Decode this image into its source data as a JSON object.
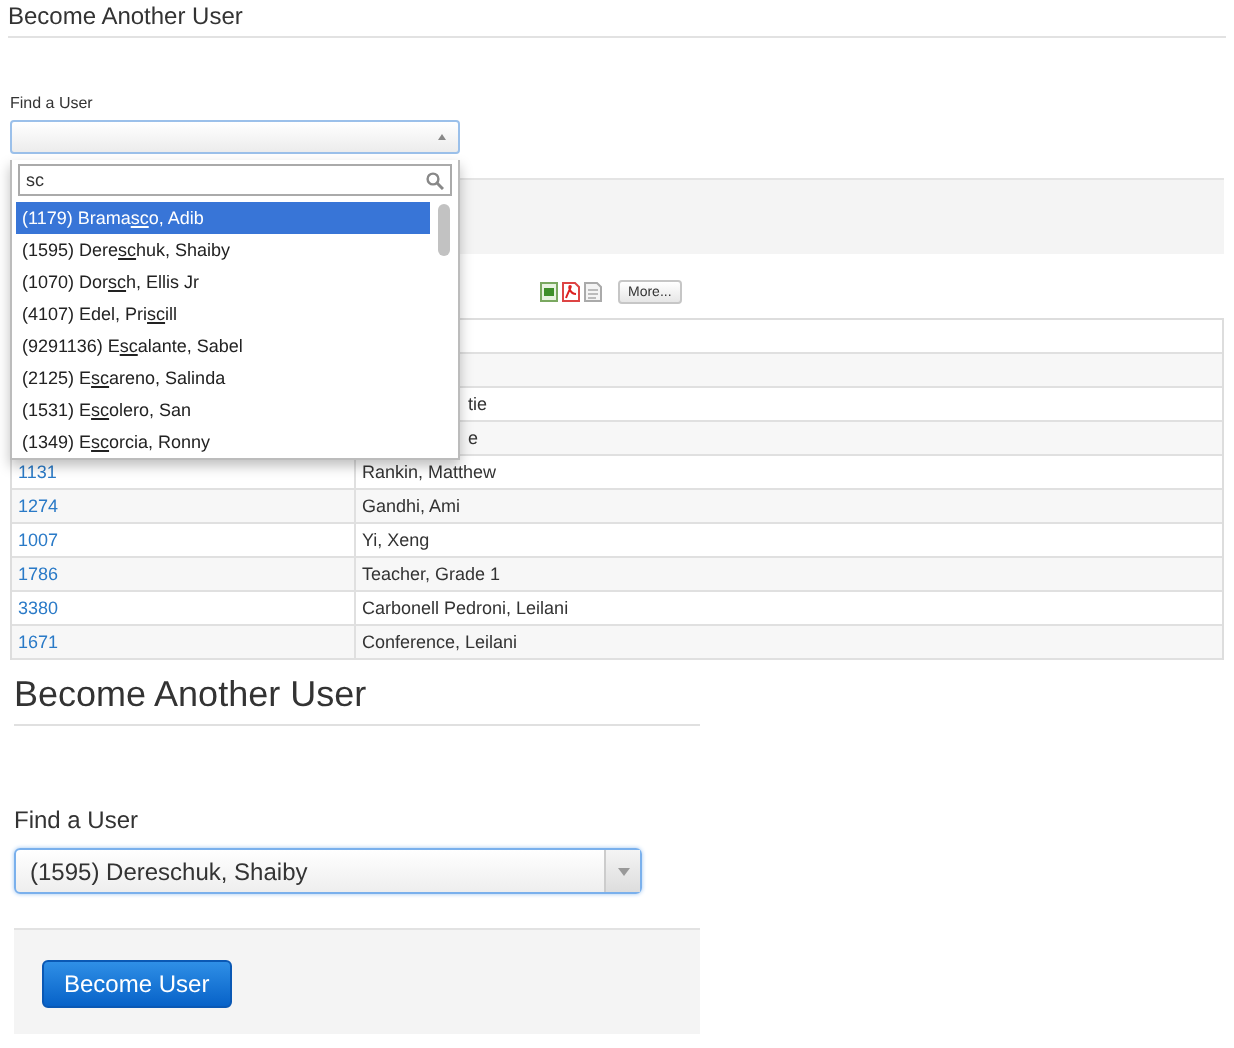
{
  "top_view": {
    "title": "Become Another User",
    "field_label": "Find a User",
    "select": {
      "expanded": true
    },
    "search": {
      "value": "sc"
    },
    "options": [
      {
        "prefix": "(1179) Brama",
        "match": "sc",
        "suffix": "o, Adib",
        "selected": true
      },
      {
        "prefix": "(1595) Dere",
        "match": "sc",
        "suffix": "huk, Shaiby",
        "selected": false
      },
      {
        "prefix": "(1070) Dor",
        "match": "sc",
        "suffix": "h, Ellis Jr",
        "selected": false
      },
      {
        "prefix": "(4107) Edel, Pri",
        "match": "sc",
        "suffix": "ill",
        "selected": false
      },
      {
        "prefix": "(9291136) E",
        "match": "sc",
        "suffix": "alante, Sabel",
        "selected": false
      },
      {
        "prefix": "(2125) E",
        "match": "sc",
        "suffix": "areno, Salinda",
        "selected": false
      },
      {
        "prefix": "(1531) E",
        "match": "sc",
        "suffix": "olero, San",
        "selected": false
      },
      {
        "prefix": "(1349) E",
        "match": "sc",
        "suffix": "orcia, Ronny",
        "selected": false
      }
    ],
    "more_button": "More...",
    "rows": [
      {
        "name": "tie"
      },
      {
        "name": "e"
      },
      {
        "id": "1131",
        "name": "Rankin, Matthew"
      },
      {
        "id": "1274",
        "name": "Gandhi, Ami"
      },
      {
        "id": "1007",
        "name": "Yi, Xeng"
      },
      {
        "id": "1786",
        "name": "Teacher, Grade 1"
      },
      {
        "id": "3380",
        "name": "Carbonell Pedroni, Leilani"
      },
      {
        "id": "1671",
        "name": "Conference, Leilani"
      }
    ]
  },
  "bottom_view": {
    "title": "Become Another User",
    "field_label": "Find a User",
    "select": {
      "value": "(1595) Dereschuk, Shaiby",
      "expanded": false
    },
    "button": "Become User"
  }
}
